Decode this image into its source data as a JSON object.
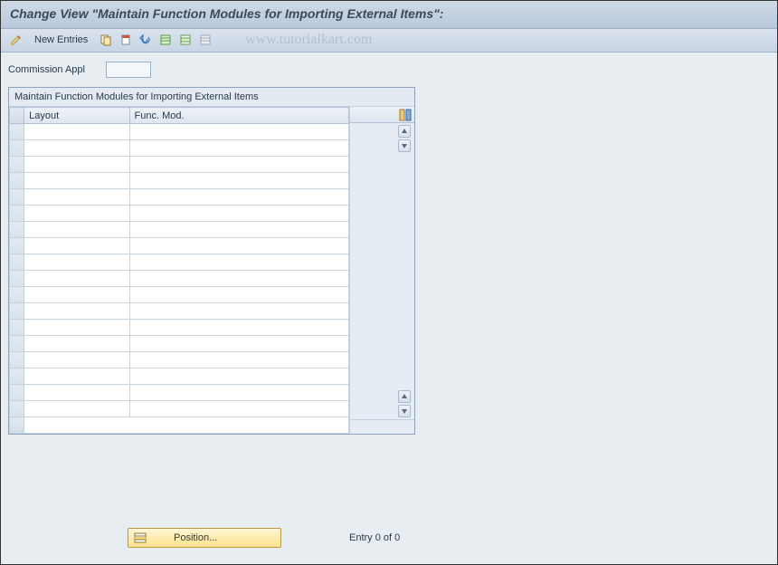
{
  "title": "Change View \"Maintain Function Modules for Importing External Items\":",
  "toolbar": {
    "new_entries_label": "New Entries"
  },
  "watermark": "www.tutorialkart.com",
  "fields": {
    "commission_appl_label": "Commission Appl",
    "commission_appl_value": ""
  },
  "table": {
    "title": "Maintain Function Modules for Importing External Items",
    "columns": {
      "layout": "Layout",
      "func_mod": "Func. Mod."
    },
    "row_count": 18
  },
  "footer": {
    "position_label": "Position...",
    "entry_status": "Entry 0 of 0"
  }
}
